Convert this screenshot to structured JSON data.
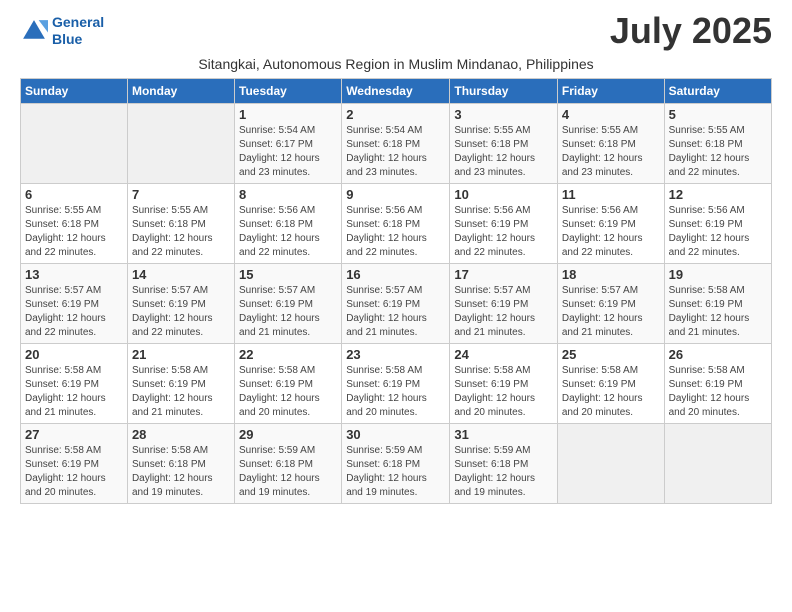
{
  "header": {
    "logo_line1": "General",
    "logo_line2": "Blue",
    "month_year": "July 2025",
    "subtitle": "Sitangkai, Autonomous Region in Muslim Mindanao, Philippines"
  },
  "days_of_week": [
    "Sunday",
    "Monday",
    "Tuesday",
    "Wednesday",
    "Thursday",
    "Friday",
    "Saturday"
  ],
  "weeks": [
    [
      {
        "day": null
      },
      {
        "day": null
      },
      {
        "day": "1",
        "sunrise": "Sunrise: 5:54 AM",
        "sunset": "Sunset: 6:17 PM",
        "daylight": "Daylight: 12 hours and 23 minutes."
      },
      {
        "day": "2",
        "sunrise": "Sunrise: 5:54 AM",
        "sunset": "Sunset: 6:18 PM",
        "daylight": "Daylight: 12 hours and 23 minutes."
      },
      {
        "day": "3",
        "sunrise": "Sunrise: 5:55 AM",
        "sunset": "Sunset: 6:18 PM",
        "daylight": "Daylight: 12 hours and 23 minutes."
      },
      {
        "day": "4",
        "sunrise": "Sunrise: 5:55 AM",
        "sunset": "Sunset: 6:18 PM",
        "daylight": "Daylight: 12 hours and 23 minutes."
      },
      {
        "day": "5",
        "sunrise": "Sunrise: 5:55 AM",
        "sunset": "Sunset: 6:18 PM",
        "daylight": "Daylight: 12 hours and 22 minutes."
      }
    ],
    [
      {
        "day": "6",
        "sunrise": "Sunrise: 5:55 AM",
        "sunset": "Sunset: 6:18 PM",
        "daylight": "Daylight: 12 hours and 22 minutes."
      },
      {
        "day": "7",
        "sunrise": "Sunrise: 5:55 AM",
        "sunset": "Sunset: 6:18 PM",
        "daylight": "Daylight: 12 hours and 22 minutes."
      },
      {
        "day": "8",
        "sunrise": "Sunrise: 5:56 AM",
        "sunset": "Sunset: 6:18 PM",
        "daylight": "Daylight: 12 hours and 22 minutes."
      },
      {
        "day": "9",
        "sunrise": "Sunrise: 5:56 AM",
        "sunset": "Sunset: 6:18 PM",
        "daylight": "Daylight: 12 hours and 22 minutes."
      },
      {
        "day": "10",
        "sunrise": "Sunrise: 5:56 AM",
        "sunset": "Sunset: 6:19 PM",
        "daylight": "Daylight: 12 hours and 22 minutes."
      },
      {
        "day": "11",
        "sunrise": "Sunrise: 5:56 AM",
        "sunset": "Sunset: 6:19 PM",
        "daylight": "Daylight: 12 hours and 22 minutes."
      },
      {
        "day": "12",
        "sunrise": "Sunrise: 5:56 AM",
        "sunset": "Sunset: 6:19 PM",
        "daylight": "Daylight: 12 hours and 22 minutes."
      }
    ],
    [
      {
        "day": "13",
        "sunrise": "Sunrise: 5:57 AM",
        "sunset": "Sunset: 6:19 PM",
        "daylight": "Daylight: 12 hours and 22 minutes."
      },
      {
        "day": "14",
        "sunrise": "Sunrise: 5:57 AM",
        "sunset": "Sunset: 6:19 PM",
        "daylight": "Daylight: 12 hours and 22 minutes."
      },
      {
        "day": "15",
        "sunrise": "Sunrise: 5:57 AM",
        "sunset": "Sunset: 6:19 PM",
        "daylight": "Daylight: 12 hours and 21 minutes."
      },
      {
        "day": "16",
        "sunrise": "Sunrise: 5:57 AM",
        "sunset": "Sunset: 6:19 PM",
        "daylight": "Daylight: 12 hours and 21 minutes."
      },
      {
        "day": "17",
        "sunrise": "Sunrise: 5:57 AM",
        "sunset": "Sunset: 6:19 PM",
        "daylight": "Daylight: 12 hours and 21 minutes."
      },
      {
        "day": "18",
        "sunrise": "Sunrise: 5:57 AM",
        "sunset": "Sunset: 6:19 PM",
        "daylight": "Daylight: 12 hours and 21 minutes."
      },
      {
        "day": "19",
        "sunrise": "Sunrise: 5:58 AM",
        "sunset": "Sunset: 6:19 PM",
        "daylight": "Daylight: 12 hours and 21 minutes."
      }
    ],
    [
      {
        "day": "20",
        "sunrise": "Sunrise: 5:58 AM",
        "sunset": "Sunset: 6:19 PM",
        "daylight": "Daylight: 12 hours and 21 minutes."
      },
      {
        "day": "21",
        "sunrise": "Sunrise: 5:58 AM",
        "sunset": "Sunset: 6:19 PM",
        "daylight": "Daylight: 12 hours and 21 minutes."
      },
      {
        "day": "22",
        "sunrise": "Sunrise: 5:58 AM",
        "sunset": "Sunset: 6:19 PM",
        "daylight": "Daylight: 12 hours and 20 minutes."
      },
      {
        "day": "23",
        "sunrise": "Sunrise: 5:58 AM",
        "sunset": "Sunset: 6:19 PM",
        "daylight": "Daylight: 12 hours and 20 minutes."
      },
      {
        "day": "24",
        "sunrise": "Sunrise: 5:58 AM",
        "sunset": "Sunset: 6:19 PM",
        "daylight": "Daylight: 12 hours and 20 minutes."
      },
      {
        "day": "25",
        "sunrise": "Sunrise: 5:58 AM",
        "sunset": "Sunset: 6:19 PM",
        "daylight": "Daylight: 12 hours and 20 minutes."
      },
      {
        "day": "26",
        "sunrise": "Sunrise: 5:58 AM",
        "sunset": "Sunset: 6:19 PM",
        "daylight": "Daylight: 12 hours and 20 minutes."
      }
    ],
    [
      {
        "day": "27",
        "sunrise": "Sunrise: 5:58 AM",
        "sunset": "Sunset: 6:19 PM",
        "daylight": "Daylight: 12 hours and 20 minutes."
      },
      {
        "day": "28",
        "sunrise": "Sunrise: 5:58 AM",
        "sunset": "Sunset: 6:18 PM",
        "daylight": "Daylight: 12 hours and 19 minutes."
      },
      {
        "day": "29",
        "sunrise": "Sunrise: 5:59 AM",
        "sunset": "Sunset: 6:18 PM",
        "daylight": "Daylight: 12 hours and 19 minutes."
      },
      {
        "day": "30",
        "sunrise": "Sunrise: 5:59 AM",
        "sunset": "Sunset: 6:18 PM",
        "daylight": "Daylight: 12 hours and 19 minutes."
      },
      {
        "day": "31",
        "sunrise": "Sunrise: 5:59 AM",
        "sunset": "Sunset: 6:18 PM",
        "daylight": "Daylight: 12 hours and 19 minutes."
      },
      {
        "day": null
      },
      {
        "day": null
      }
    ]
  ]
}
